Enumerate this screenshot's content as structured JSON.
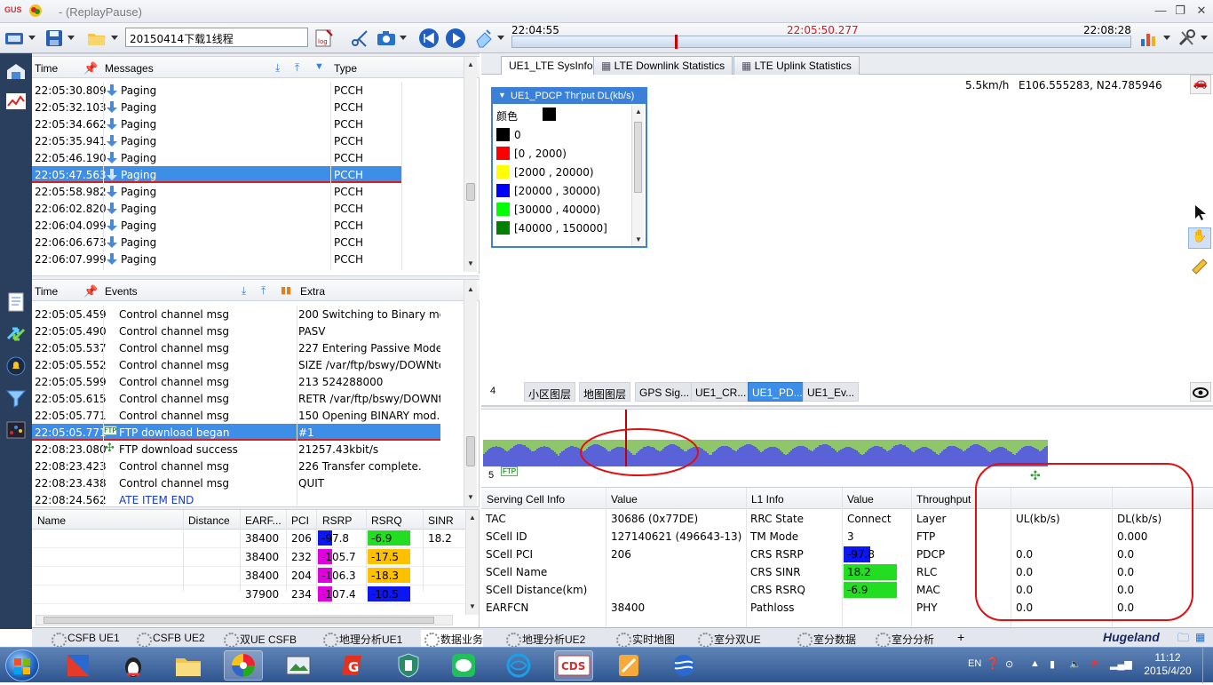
{
  "window": {
    "title": "- (ReplayPause)"
  },
  "toolbar": {
    "file_name": "20150414下载1线程"
  },
  "timeline": {
    "start": "22:04:55",
    "current": "22:05:50.277",
    "end": "22:08:28"
  },
  "messages": {
    "headers": {
      "time": "Time",
      "messages": "Messages",
      "type": "Type"
    },
    "rows": [
      {
        "time": "22:05:30.809",
        "msg": "Paging",
        "type": "PCCH"
      },
      {
        "time": "22:05:32.103",
        "msg": "Paging",
        "type": "PCCH"
      },
      {
        "time": "22:05:34.662",
        "msg": "Paging",
        "type": "PCCH"
      },
      {
        "time": "22:05:35.941",
        "msg": "Paging",
        "type": "PCCH"
      },
      {
        "time": "22:05:46.190",
        "msg": "Paging",
        "type": "PCCH"
      },
      {
        "time": "22:05:47.563",
        "msg": "Paging",
        "type": "PCCH"
      },
      {
        "time": "22:05:58.982",
        "msg": "Paging",
        "type": "PCCH"
      },
      {
        "time": "22:06:02.820",
        "msg": "Paging",
        "type": "PCCH"
      },
      {
        "time": "22:06:04.099",
        "msg": "Paging",
        "type": "PCCH"
      },
      {
        "time": "22:06:06.673",
        "msg": "Paging",
        "type": "PCCH"
      },
      {
        "time": "22:06:07.999",
        "msg": "Paging",
        "type": "PCCH"
      }
    ]
  },
  "events": {
    "headers": {
      "time": "Time",
      "events": "Events",
      "extra": "Extra"
    },
    "rows": [
      {
        "time": "22:05:05.459",
        "event": "Control channel msg",
        "extra": "200 Switching to Binary mo..."
      },
      {
        "time": "22:05:05.490",
        "event": "Control channel msg",
        "extra": "PASV"
      },
      {
        "time": "22:05:05.537",
        "event": "Control channel msg",
        "extra": "227 Entering Passive Mode..."
      },
      {
        "time": "22:05:05.552",
        "event": "Control channel msg",
        "extra": "SIZE /var/ftp/bswy/DOWNte..."
      },
      {
        "time": "22:05:05.599",
        "event": "Control channel msg",
        "extra": "213 524288000"
      },
      {
        "time": "22:05:05.615",
        "event": "Control channel msg",
        "extra": "RETR /var/ftp/bswy/DOWNt..."
      },
      {
        "time": "22:05:05.771",
        "event": "Control channel msg",
        "extra": "150 Opening BINARY mod..."
      },
      {
        "time": "22:05:05.771",
        "event": "FTP download began",
        "extra": "#1"
      },
      {
        "time": "22:08:23.080",
        "event": "FTP download success",
        "extra": "21257.43kbit/s"
      },
      {
        "time": "22:08:23.423",
        "event": "Control channel msg",
        "extra": "226 Transfer complete."
      },
      {
        "time": "22:08:23.438",
        "event": "Control channel msg",
        "extra": "QUIT"
      },
      {
        "time": "22:08:24.562",
        "event": "ATE ITEM END",
        "extra": ""
      }
    ]
  },
  "cells": {
    "headers": {
      "name": "Name",
      "distance": "Distance",
      "earfcn": "EARF...",
      "pci": "PCI",
      "rsrp": "RSRP",
      "rsrq": "RSRQ",
      "sinr": "SINR"
    },
    "rows": [
      {
        "earfcn": "38400",
        "pci": "206",
        "rsrp": "-97.8",
        "rsrq": "-6.9",
        "sinr": "18.2",
        "rsrp_color": "#0b16f0",
        "rsrq_color": "#22dd22"
      },
      {
        "earfcn": "38400",
        "pci": "232",
        "rsrp": "-105.7",
        "rsrq": "-17.5",
        "sinr": "",
        "rsrp_color": "#e000e0",
        "rsrq_color": "#ffc000"
      },
      {
        "earfcn": "38400",
        "pci": "204",
        "rsrp": "-106.3",
        "rsrq": "-18.3",
        "sinr": "",
        "rsrp_color": "#e000e0",
        "rsrq_color": "#ffc000"
      },
      {
        "earfcn": "37900",
        "pci": "234",
        "rsrp": "-107.4",
        "rsrq": "-10.5",
        "sinr": "",
        "rsrp_color": "#e000e0",
        "rsrq_color": "#0b16f0"
      }
    ]
  },
  "top_tabs": [
    "UE1_LTE SysInfo",
    "LTE Downlink Statistics",
    "LTE Uplink Statistics"
  ],
  "map": {
    "speed": "5.5km/h",
    "coords": "E106.555283, N24.785946",
    "legend_title": "UE1_PDCP Thr'put DL(kb/s)",
    "legend_color_label": "颜色",
    "legend_items": [
      {
        "label": "0",
        "color": "#000000"
      },
      {
        "label": "[0 , 2000)",
        "color": "#ff0000"
      },
      {
        "label": "[2000 , 20000)",
        "color": "#ffff00"
      },
      {
        "label": "[20000 , 30000)",
        "color": "#0000ff"
      },
      {
        "label": "[30000 , 40000)",
        "color": "#00ff00"
      },
      {
        "label": "[40000 , 150000]",
        "color": "#008000"
      }
    ],
    "tabs_number": "4",
    "tabs": [
      "小区图层",
      "地图图层",
      "GPS Sig...",
      "UE1_CR...",
      "UE1_PD...",
      "UE1_Ev..."
    ]
  },
  "chart": {
    "number": "5",
    "ftp_label": "FTP"
  },
  "info": {
    "headers": {
      "serving": "Serving Cell Info",
      "value": "Value",
      "l1": "L1 Info",
      "l1value": "Value",
      "throughput": "Throughput"
    },
    "serving": [
      {
        "label": "TAC",
        "value": "30686 (0x77DE)"
      },
      {
        "label": "SCell ID",
        "value": "127140621 (496643-13) (0"
      },
      {
        "label": "SCell PCI",
        "value": "206"
      },
      {
        "label": "SCell Name",
        "value": ""
      },
      {
        "label": "SCell Distance(km)",
        "value": ""
      },
      {
        "label": "EARFCN",
        "value": "38400"
      }
    ],
    "l1": [
      {
        "label": "RRC State",
        "value": "Connect",
        "color": ""
      },
      {
        "label": "TM Mode",
        "value": "3",
        "color": ""
      },
      {
        "label": "CRS RSRP",
        "value": "-97.8",
        "color": "#0b16f0"
      },
      {
        "label": "CRS SINR",
        "value": "18.2",
        "color": "#22dd22"
      },
      {
        "label": "CRS RSRQ",
        "value": "-6.9",
        "color": "#22dd22"
      },
      {
        "label": "Pathloss",
        "value": "",
        "color": ""
      }
    ],
    "tp_headers": {
      "layer": "Layer",
      "ul": "UL(kb/s)",
      "dl": "DL(kb/s)"
    },
    "throughput": [
      {
        "layer": "FTP",
        "ul": "",
        "dl": "0.000"
      },
      {
        "layer": "PDCP",
        "ul": "0.0",
        "dl": "0.0"
      },
      {
        "layer": "RLC",
        "ul": "0.0",
        "dl": "0.0"
      },
      {
        "layer": "MAC",
        "ul": "0.0",
        "dl": "0.0"
      },
      {
        "layer": "PHY",
        "ul": "0.0",
        "dl": "0.0"
      }
    ]
  },
  "bottom_tabs": [
    "CSFB UE1",
    "CSFB UE2",
    "双UE CSFB",
    "地理分析UE1",
    "数据业务",
    "地理分析UE2",
    "实时地图",
    "室分双UE",
    "室分数据",
    "室分分析"
  ],
  "bottom_plus": "+",
  "brand": "Hugeland",
  "taskbar": {
    "lang": "EN",
    "time": "11:12",
    "date": "2015/4/20"
  }
}
